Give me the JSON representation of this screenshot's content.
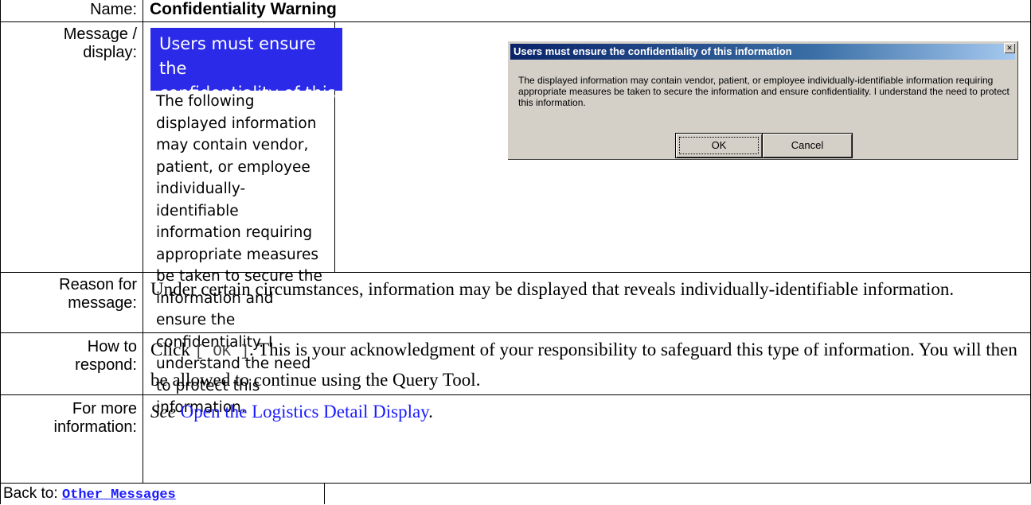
{
  "rows": {
    "name": {
      "label": "Name:",
      "value": "Confidentiality Warning"
    },
    "message": {
      "label_line1": "Message /",
      "label_line2": "display:",
      "banner_line1": "Users must ensure the",
      "banner_line2": "confidentiality of this information",
      "text": "The following displayed information may contain vendor, patient, or employee individually-identifiable information requiring appropriate measures be taken to secure the information and ensure the confidentiality. I understand the need to protect this information."
    },
    "reason": {
      "label_line1": "Reason for",
      "label_line2": "message:",
      "text": "Under certain circumstances, information may be displayed that reveals individually-identifiable information."
    },
    "respond": {
      "label_line1": "How to",
      "label_line2": "respond:",
      "text_before": "Click",
      "button_text": "[ OK ]",
      "text_after": ". This is your acknowledgment of your responsibility to safeguard this type of information. You will then be allowed to continue using the Query Tool."
    },
    "more": {
      "label_line1": "For more",
      "label_line2": "information:",
      "see": "See",
      "link_text": "Open the Logistics Detail Display",
      "period": "."
    },
    "back": {
      "label": "Back to:",
      "link_text": "Other Messages"
    }
  },
  "dialog": {
    "title": "Users must ensure the confidentiality of this information",
    "close_glyph": "×",
    "body": "The displayed information may contain vendor, patient, or employee individually-identifiable information requiring appropriate measures be taken to secure the information and ensure confidentiality. I understand the need to protect this information.",
    "ok_label": "OK",
    "cancel_label": "Cancel"
  }
}
